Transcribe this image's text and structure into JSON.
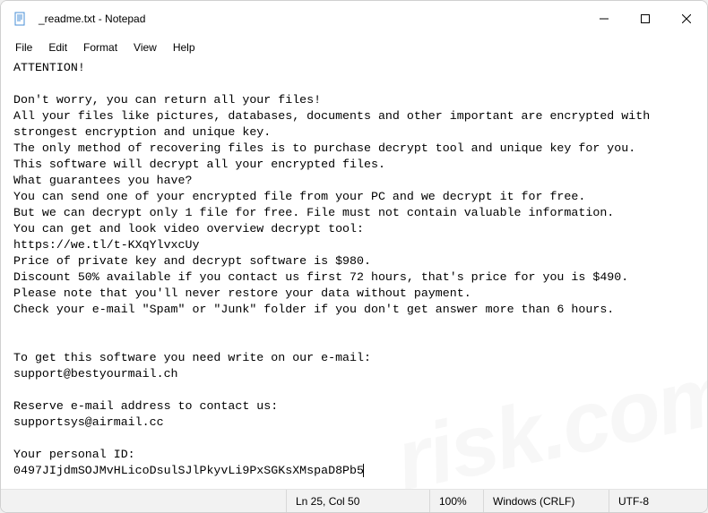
{
  "title": "_readme.txt - Notepad",
  "menu": {
    "file": "File",
    "edit": "Edit",
    "format": "Format",
    "view": "View",
    "help": "Help"
  },
  "content": "ATTENTION!\n\nDon't worry, you can return all your files!\nAll your files like pictures, databases, documents and other important are encrypted with strongest encryption and unique key.\nThe only method of recovering files is to purchase decrypt tool and unique key for you.\nThis software will decrypt all your encrypted files.\nWhat guarantees you have?\nYou can send one of your encrypted file from your PC and we decrypt it for free.\nBut we can decrypt only 1 file for free. File must not contain valuable information.\nYou can get and look video overview decrypt tool:\nhttps://we.tl/t-KXqYlvxcUy\nPrice of private key and decrypt software is $980.\nDiscount 50% available if you contact us first 72 hours, that's price for you is $490.\nPlease note that you'll never restore your data without payment.\nCheck your e-mail \"Spam\" or \"Junk\" folder if you don't get answer more than 6 hours.\n\n\nTo get this software you need write on our e-mail:\nsupport@bestyourmail.ch\n\nReserve e-mail address to contact us:\nsupportsys@airmail.cc\n\nYour personal ID:\n0497JIjdmSOJMvHLicoDsulSJlPkyvLi9PxSGKsXMspaD8Pb5",
  "status": {
    "cursor": "Ln 25, Col 50",
    "zoom": "100%",
    "lineend": "Windows (CRLF)",
    "encoding": "UTF-8"
  },
  "watermark": "risk.com"
}
